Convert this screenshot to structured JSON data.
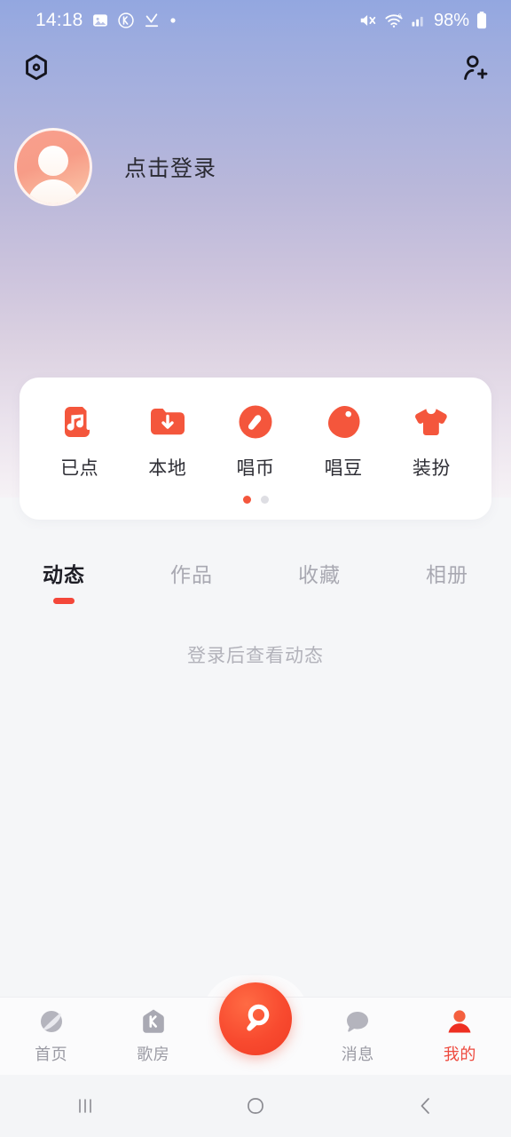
{
  "status_bar": {
    "time": "14:18",
    "battery_percent": "98%",
    "left_icons": [
      "image-icon",
      "kugou-k-icon",
      "download-complete-icon",
      "dot-indicator-icon"
    ],
    "right_icons": [
      "mute-icon",
      "wifi-6-icon",
      "cellular-signal-icon",
      "battery-icon"
    ]
  },
  "app_header": {
    "settings_icon": "hexagon-settings-icon",
    "add_friend_icon": "add-person-icon"
  },
  "profile": {
    "login_label": "点击登录",
    "avatar_icon": "default-avatar-icon"
  },
  "quick_actions": {
    "items": [
      {
        "label": "已点",
        "icon": "music-note-list-icon"
      },
      {
        "label": "本地",
        "icon": "folder-download-icon"
      },
      {
        "label": "唱币",
        "icon": "coin-icon"
      },
      {
        "label": "唱豆",
        "icon": "bean-icon"
      },
      {
        "label": "装扮",
        "icon": "tshirt-icon"
      }
    ],
    "page_dots": 2,
    "active_dot": 0,
    "accent_color": "#f4563c"
  },
  "tabs": {
    "items": [
      {
        "label": "动态",
        "active": true
      },
      {
        "label": "作品",
        "active": false
      },
      {
        "label": "收藏",
        "active": false
      },
      {
        "label": "相册",
        "active": false
      }
    ],
    "underline_color": "#f4473a"
  },
  "content": {
    "empty_message": "登录后查看动态"
  },
  "bottom_nav": {
    "items": [
      {
        "label": "首页",
        "icon": "planet-icon",
        "active": false
      },
      {
        "label": "歌房",
        "icon": "karaoke-room-k-icon",
        "active": false
      },
      {
        "label": "消息",
        "icon": "chat-bubble-icon",
        "active": false
      },
      {
        "label": "我的",
        "icon": "person-icon",
        "active": true
      }
    ],
    "fab_icon": "microphone-sing-icon",
    "active_color": "#ee4a3f"
  },
  "system_nav": {
    "recents_icon": "recents-icon",
    "home_icon": "home-icon",
    "back_icon": "back-icon"
  }
}
